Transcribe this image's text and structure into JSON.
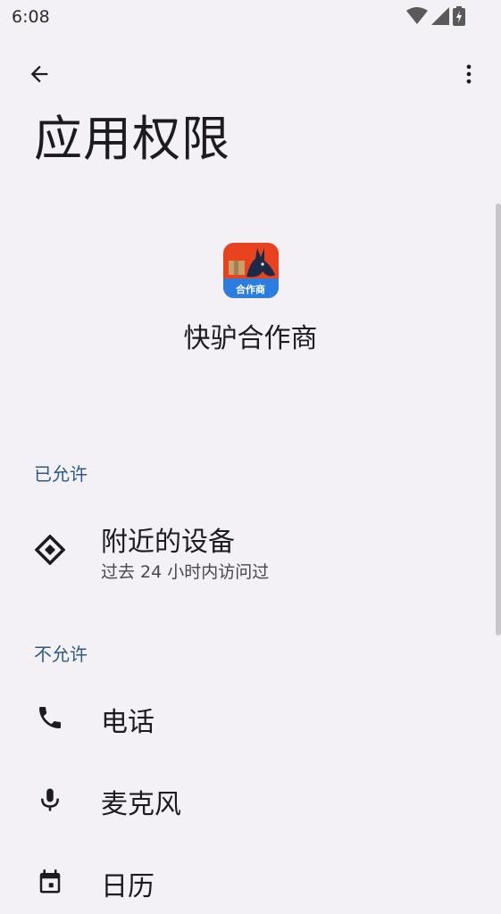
{
  "status_bar": {
    "time": "6:08"
  },
  "top_bar": {
    "back_icon": "arrow-back-icon",
    "more_icon": "more-vert-icon"
  },
  "page": {
    "title": "应用权限"
  },
  "app": {
    "name": "快驴合作商",
    "icon_badge": "合作商",
    "icon_colors": {
      "top": "#e8431e",
      "bottom": "#2b7ee0"
    }
  },
  "sections": {
    "allowed": {
      "header": "已允许",
      "items": [
        {
          "title": "附近的设备",
          "subtitle": "过去 24 小时内访问过",
          "icon": "nearby-devices-icon"
        }
      ]
    },
    "denied": {
      "header": "不允许",
      "items": [
        {
          "title": "电话",
          "icon": "phone-icon"
        },
        {
          "title": "麦克风",
          "icon": "microphone-icon"
        },
        {
          "title": "日历",
          "icon": "calendar-icon"
        }
      ]
    }
  },
  "colors": {
    "background": "#F3F1F6",
    "section_header": "#2d5a86"
  }
}
